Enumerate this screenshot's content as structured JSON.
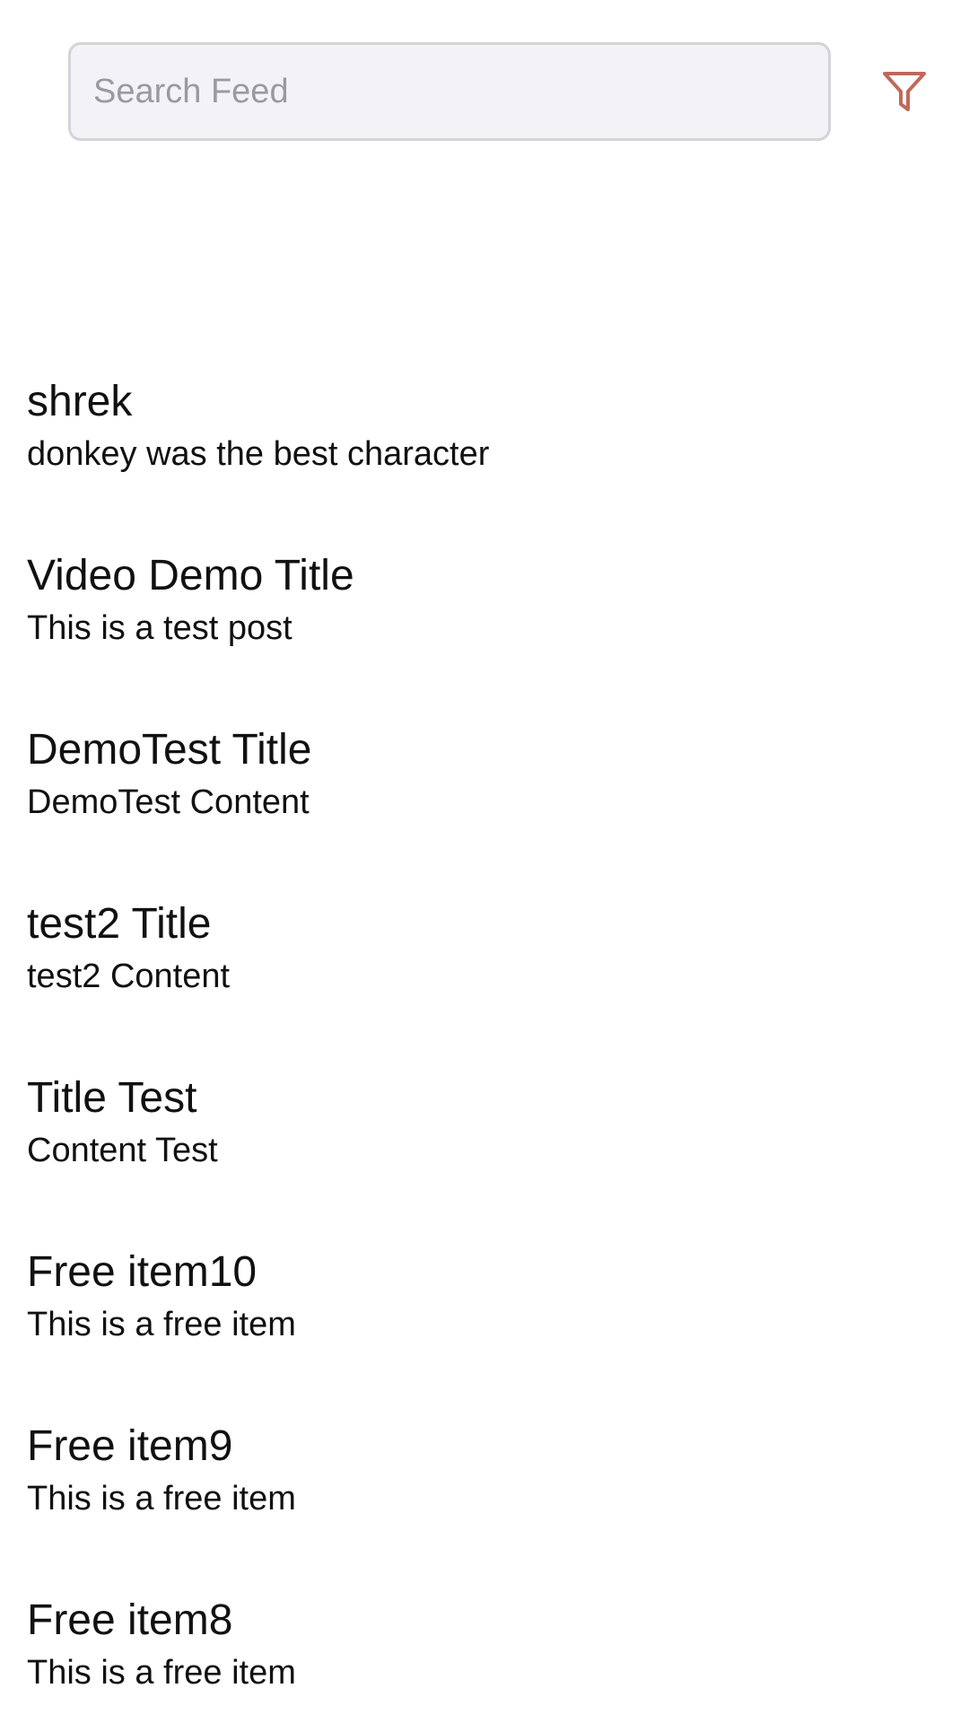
{
  "search": {
    "placeholder": "Search Feed",
    "value": ""
  },
  "filter": {
    "icon": "filter-icon",
    "color": "#c0695a"
  },
  "feed": {
    "items": [
      {
        "title": "shrek",
        "content": "donkey was the best character"
      },
      {
        "title": "Video Demo Title",
        "content": "This is a test post"
      },
      {
        "title": "DemoTest Title",
        "content": "DemoTest Content"
      },
      {
        "title": "test2 Title",
        "content": "test2 Content"
      },
      {
        "title": "Title Test",
        "content": "Content Test"
      },
      {
        "title": "Free item10",
        "content": "This is a free item"
      },
      {
        "title": "Free item9",
        "content": "This is a free item"
      },
      {
        "title": "Free item8",
        "content": "This is a free item"
      }
    ]
  }
}
